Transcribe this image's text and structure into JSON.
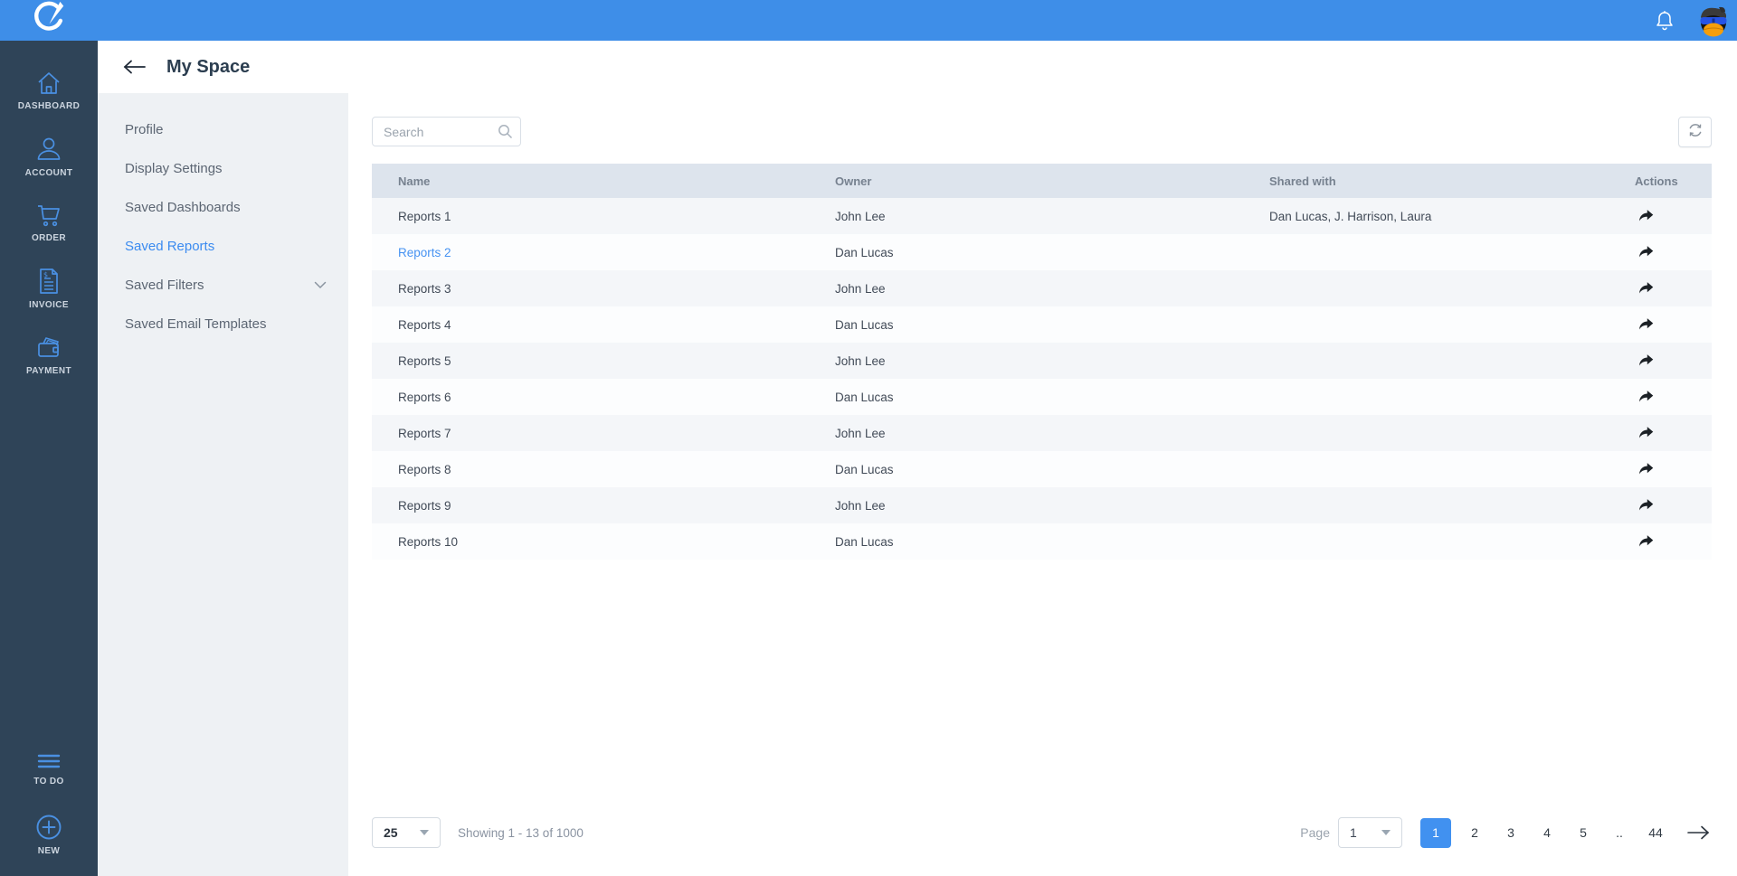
{
  "topbar": {
    "logo_icon": "brand-logo",
    "bell_icon": "notification-bell",
    "avatar_icon": "penguin-avatar"
  },
  "sidebar": {
    "items": [
      {
        "label": "DASHBOARD",
        "icon": "home-icon"
      },
      {
        "label": "ACCOUNT",
        "icon": "user-icon"
      },
      {
        "label": "ORDER",
        "icon": "cart-icon"
      },
      {
        "label": "INVOICE",
        "icon": "invoice-icon"
      },
      {
        "label": "PAYMENT",
        "icon": "wallet-icon"
      }
    ],
    "bottom_items": [
      {
        "label": "TO DO",
        "icon": "list-icon"
      },
      {
        "label": "NEW",
        "icon": "plus-circle-icon"
      }
    ]
  },
  "header": {
    "title": "My Space"
  },
  "settings_menu": {
    "items": [
      {
        "label": "Profile"
      },
      {
        "label": "Display Settings"
      },
      {
        "label": "Saved Dashboards"
      },
      {
        "label": "Saved Reports",
        "active": true
      },
      {
        "label": "Saved Filters",
        "chevron": true
      },
      {
        "label": "Saved Email Templates"
      }
    ]
  },
  "main": {
    "search_placeholder": "Search",
    "table": {
      "columns": {
        "name": "Name",
        "owner": "Owner",
        "shared": "Shared with",
        "actions": "Actions"
      },
      "rows": [
        {
          "name": "Reports 1",
          "owner": "John Lee",
          "shared_with": "Dan Lucas,  J. Harrison, Laura",
          "link": false
        },
        {
          "name": "Reports 2",
          "owner": "Dan Lucas",
          "shared_with": "",
          "link": true
        },
        {
          "name": "Reports 3",
          "owner": "John Lee",
          "shared_with": "",
          "link": false
        },
        {
          "name": "Reports 4",
          "owner": "Dan Lucas",
          "shared_with": "",
          "link": false
        },
        {
          "name": "Reports 5",
          "owner": "John Lee",
          "shared_with": "",
          "link": false
        },
        {
          "name": "Reports 6",
          "owner": "Dan Lucas",
          "shared_with": "",
          "link": false
        },
        {
          "name": "Reports 7",
          "owner": "John Lee",
          "shared_with": "",
          "link": false
        },
        {
          "name": "Reports 8",
          "owner": "Dan Lucas",
          "shared_with": "",
          "link": false
        },
        {
          "name": "Reports 9",
          "owner": "John Lee",
          "shared_with": "",
          "link": false
        },
        {
          "name": "Reports 10",
          "owner": "Dan Lucas",
          "shared_with": "",
          "link": false
        }
      ]
    },
    "pagination": {
      "page_size": "25",
      "showing": "Showing 1 - 13 of 1000",
      "page_label": "Page",
      "page_select_value": "1",
      "pages": [
        {
          "label": "1",
          "active": true
        },
        {
          "label": "2"
        },
        {
          "label": "3"
        },
        {
          "label": "4"
        },
        {
          "label": "5"
        },
        {
          "label": ".."
        },
        {
          "label": "44"
        }
      ]
    }
  },
  "colors": {
    "topbar_blue": "#3e8ee8",
    "sidebar_navy": "#2f4458",
    "accent_blue": "#4191f0",
    "link_blue": "#4793f2",
    "panel_gray": "#eef1f4",
    "table_header_bg": "#dde4ed",
    "icon_blue": "#4a90e2"
  }
}
